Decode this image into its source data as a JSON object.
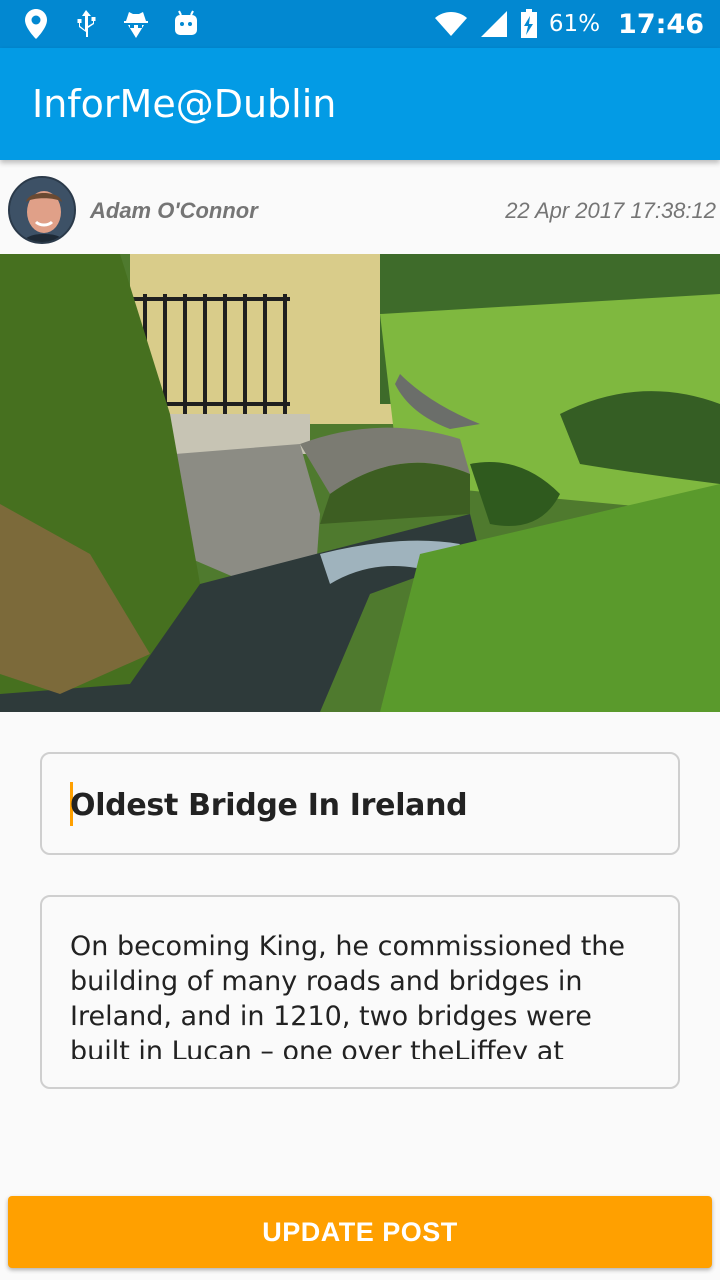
{
  "status_bar": {
    "icons_left": [
      "location-pin-icon",
      "usb-icon",
      "incognito-spy-icon",
      "android-icon"
    ],
    "icons_right": [
      "wifi-icon",
      "cell-signal-icon",
      "battery-charging-icon"
    ],
    "battery_percent": "61%",
    "time": "17:46"
  },
  "app_bar": {
    "title": "InforMe@Dublin"
  },
  "post": {
    "author_name": "Adam O'Connor",
    "timestamp": "22 Apr 2017 17:38:12",
    "photo_icon": "bridge-photo",
    "title": "Oldest Bridge In Ireland",
    "body": "On becoming King, he commissioned the building of many roads and bridges in Ireland, and in 1210, two bridges were built in Lucan – one over theLiffey at Bleach"
  },
  "actions": {
    "update_label": "UPDATE POST"
  },
  "colors": {
    "status_bar": "#0288d1",
    "app_bar": "#039be5",
    "accent": "#ffa000"
  }
}
